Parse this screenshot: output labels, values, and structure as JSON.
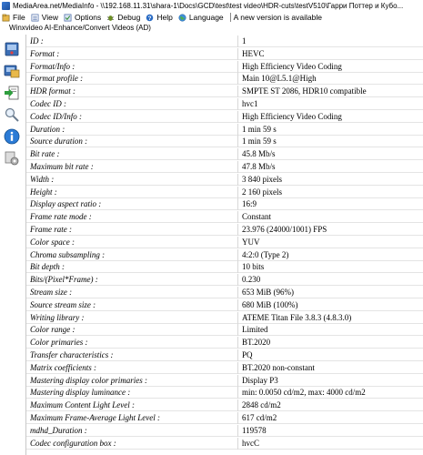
{
  "window": {
    "title": "MediaArea.net/MediaInfo - \\\\192.168.11.31\\shara-1\\Docs\\GCD\\test\\test video\\HDR-cuts\\testV510\\Гарри Поттер и Кубо..."
  },
  "menu": {
    "items": [
      {
        "label": "File",
        "icon": "file-icon"
      },
      {
        "label": "View",
        "icon": "view-icon"
      },
      {
        "label": "Options",
        "icon": "options-icon"
      },
      {
        "label": "Debug",
        "icon": "debug-icon"
      },
      {
        "label": "Help",
        "icon": "help-icon"
      },
      {
        "label": "Language",
        "icon": "language-icon"
      }
    ],
    "note": "A new version is available"
  },
  "subtitle": "Winxvideo AI-Enhance/Convert Videos (AD)",
  "sidebar": {
    "buttons": [
      "open-file-icon",
      "open-folder-icon",
      "export-icon",
      "find-icon",
      "info-icon",
      "preferences-icon"
    ]
  },
  "rows": [
    {
      "key": "ID :",
      "value": "1"
    },
    {
      "key": "Format :",
      "value": "HEVC"
    },
    {
      "key": "Format/Info :",
      "value": "High Efficiency Video Coding"
    },
    {
      "key": "Format profile :",
      "value": "Main 10@L5.1@High"
    },
    {
      "key": "HDR format :",
      "value": "SMPTE ST 2086, HDR10 compatible"
    },
    {
      "key": "Codec ID :",
      "value": "hvc1"
    },
    {
      "key": "Codec ID/Info :",
      "value": "High Efficiency Video Coding"
    },
    {
      "key": "Duration :",
      "value": "1 min 59 s"
    },
    {
      "key": "Source duration :",
      "value": "1 min 59 s"
    },
    {
      "key": "Bit rate :",
      "value": "45.8 Mb/s"
    },
    {
      "key": "Maximum bit rate :",
      "value": "47.8 Mb/s"
    },
    {
      "key": "Width :",
      "value": "3 840 pixels"
    },
    {
      "key": "Height :",
      "value": "2 160 pixels"
    },
    {
      "key": "Display aspect ratio :",
      "value": "16:9"
    },
    {
      "key": "Frame rate mode :",
      "value": "Constant"
    },
    {
      "key": "Frame rate :",
      "value": "23.976 (24000/1001) FPS"
    },
    {
      "key": "Color space :",
      "value": "YUV"
    },
    {
      "key": "Chroma subsampling :",
      "value": "4:2:0 (Type 2)"
    },
    {
      "key": "Bit depth :",
      "value": "10 bits"
    },
    {
      "key": "Bits/(Pixel*Frame) :",
      "value": "0.230"
    },
    {
      "key": "Stream size :",
      "value": "653 MiB (96%)"
    },
    {
      "key": "Source stream size :",
      "value": "680 MiB (100%)"
    },
    {
      "key": "Writing library :",
      "value": "ATEME Titan File 3.8.3 (4.8.3.0)"
    },
    {
      "key": "Color range :",
      "value": "Limited"
    },
    {
      "key": "Color primaries :",
      "value": "BT.2020"
    },
    {
      "key": "Transfer characteristics :",
      "value": "PQ"
    },
    {
      "key": "Matrix coefficients :",
      "value": "BT.2020 non-constant"
    },
    {
      "key": "Mastering display color primaries :",
      "value": "Display P3"
    },
    {
      "key": "Mastering display luminance :",
      "value": "min: 0.0050 cd/m2, max: 4000 cd/m2"
    },
    {
      "key": "Maximum Content Light Level :",
      "value": "2848 cd/m2"
    },
    {
      "key": "Maximum Frame-Average Light Level :",
      "value": "617 cd/m2"
    },
    {
      "key": "mdhd_Duration :",
      "value": "119578"
    },
    {
      "key": "Codec configuration box :",
      "value": "hvcC"
    }
  ]
}
